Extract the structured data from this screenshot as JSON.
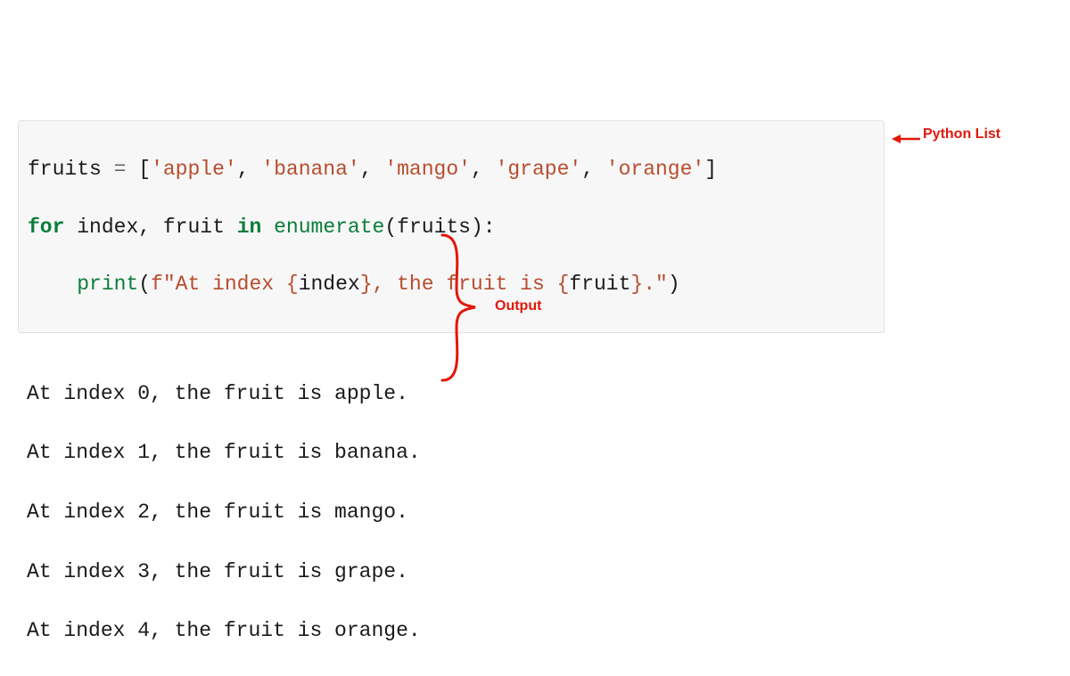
{
  "code": {
    "line1": {
      "var": "fruits",
      "eq": " = ",
      "lb": "[",
      "s1": "'apple'",
      "c1": ", ",
      "s2": "'banana'",
      "c2": ", ",
      "s3": "'mango'",
      "c3": ", ",
      "s4": "'grape'",
      "c4": ", ",
      "s5": "'orange'",
      "rb": "]"
    },
    "line2": {
      "kw_for": "for",
      "sp1": " ",
      "v_index": "index",
      "comma": ", ",
      "v_fruit": "fruit",
      "sp2": " ",
      "kw_in": "in",
      "sp3": " ",
      "fn_enum": "enumerate",
      "lp": "(",
      "arg": "fruits",
      "rp": "):"
    },
    "line3": {
      "indent": "    ",
      "fn_print": "print",
      "lp": "(",
      "fprefix": "f\"At index ",
      "brace1_open": "{",
      "expr1": "index",
      "brace1_close": "}",
      "mid": ", the fruit is ",
      "brace2_open": "{",
      "expr2": "fruit",
      "brace2_close": "}",
      "suffix": ".\"",
      "rp": ")"
    }
  },
  "output": {
    "l0": "At index 0, the fruit is apple.",
    "l1": "At index 1, the fruit is banana.",
    "l2": "At index 2, the fruit is mango.",
    "l3": "At index 3, the fruit is grape.",
    "l4": "At index 4, the fruit is orange."
  },
  "annotations": {
    "python_list": "Python List",
    "output_label": "Output",
    "arrow_glyph": "←"
  },
  "colors": {
    "annotation": "#e3170a",
    "keyword": "#0a7d3a",
    "string": "#b84c2e",
    "code_bg": "#f7f7f7"
  }
}
